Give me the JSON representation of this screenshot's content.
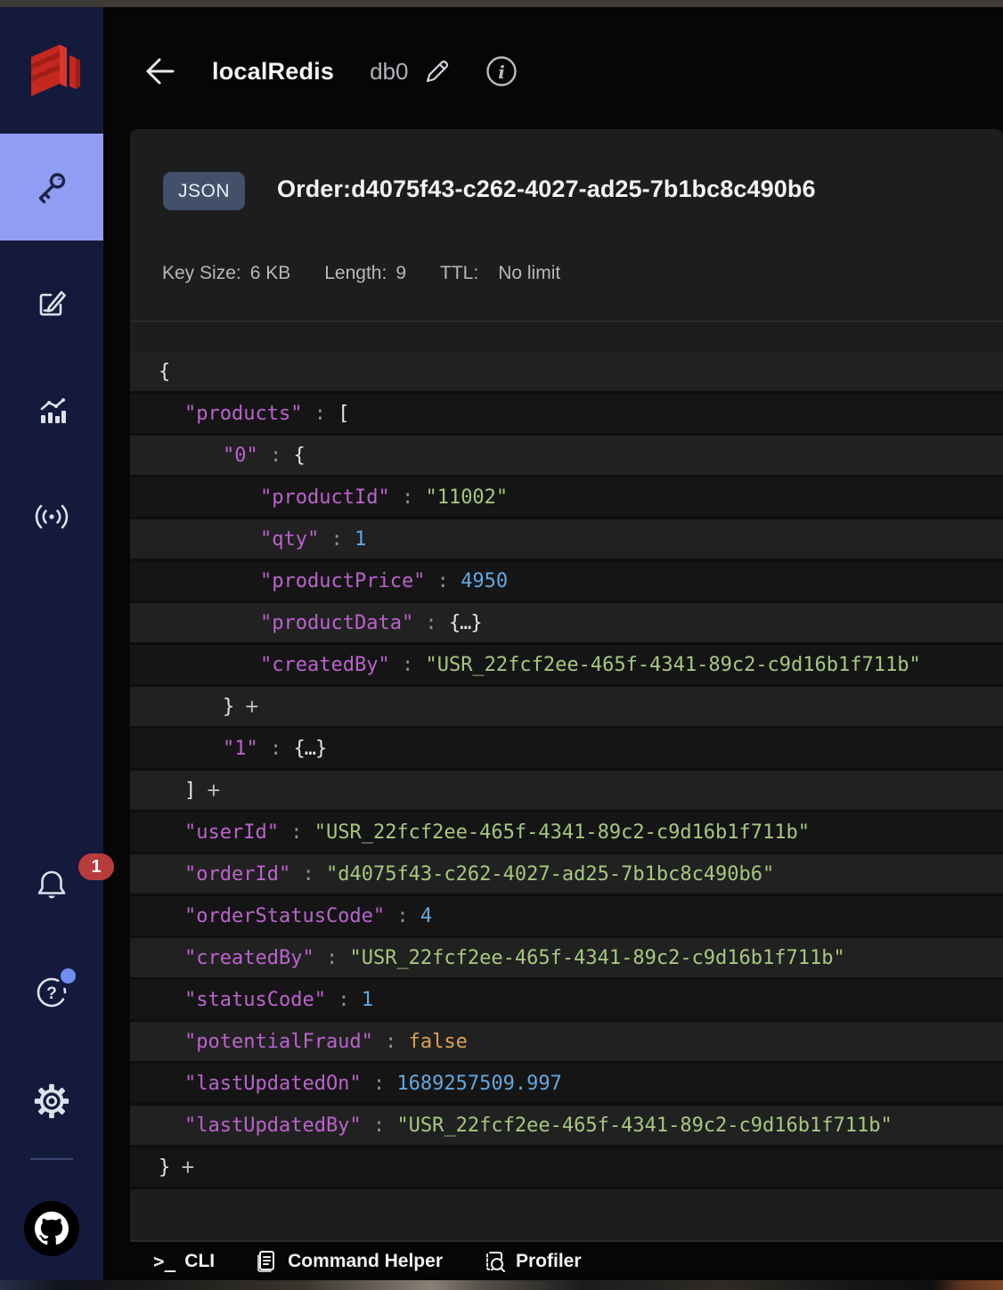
{
  "header": {
    "title": "localRedis",
    "db": "db0"
  },
  "key_panel": {
    "type_badge": "JSON",
    "key_name": "Order:d4075f43-c262-4027-ad25-7b1bc8c490b6",
    "meta": [
      {
        "label": "Key Size:",
        "value": "6 KB"
      },
      {
        "label": "Length:",
        "value": "9"
      },
      {
        "label": "TTL:",
        "value": "No limit"
      }
    ]
  },
  "sidebar": {
    "notification_count": "1",
    "icons": [
      "redis-logo",
      "browser-key-icon",
      "workbench-edit-icon",
      "analytics-icon",
      "pubsub-icon",
      "notifications-bell-icon",
      "help-icon",
      "settings-gear-icon",
      "github-icon"
    ]
  },
  "json_viewer": {
    "rows": [
      {
        "indent": 0,
        "tokens": [
          {
            "t": "{",
            "c": "bracket"
          }
        ]
      },
      {
        "indent": 1,
        "tokens": [
          {
            "t": "\"products\"",
            "c": "key"
          },
          {
            "t": " : ",
            "c": "punct"
          },
          {
            "t": "[",
            "c": "bracket"
          }
        ]
      },
      {
        "indent": 2,
        "tokens": [
          {
            "t": "\"0\"",
            "c": "key"
          },
          {
            "t": " : ",
            "c": "punct"
          },
          {
            "t": "{",
            "c": "bracket"
          }
        ]
      },
      {
        "indent": 3,
        "tokens": [
          {
            "t": "\"productId\"",
            "c": "key"
          },
          {
            "t": " : ",
            "c": "punct"
          },
          {
            "t": "\"11002\"",
            "c": "string"
          }
        ]
      },
      {
        "indent": 3,
        "tokens": [
          {
            "t": "\"qty\"",
            "c": "key"
          },
          {
            "t": " : ",
            "c": "punct"
          },
          {
            "t": "1",
            "c": "number"
          }
        ]
      },
      {
        "indent": 3,
        "tokens": [
          {
            "t": "\"productPrice\"",
            "c": "key"
          },
          {
            "t": " : ",
            "c": "punct"
          },
          {
            "t": "4950",
            "c": "number"
          }
        ]
      },
      {
        "indent": 3,
        "tokens": [
          {
            "t": "\"productData\"",
            "c": "key"
          },
          {
            "t": " : ",
            "c": "punct"
          },
          {
            "t": "{…}",
            "c": "collapsed"
          }
        ]
      },
      {
        "indent": 3,
        "tokens": [
          {
            "t": "\"createdBy\"",
            "c": "key"
          },
          {
            "t": " : ",
            "c": "punct"
          },
          {
            "t": "\"USR_22fcf2ee-465f-4341-89c2-c9d16b1f711b\"",
            "c": "string"
          }
        ]
      },
      {
        "indent": 2,
        "tokens": [
          {
            "t": "}",
            "c": "bracket"
          },
          {
            "t": "+",
            "c": "plus"
          }
        ]
      },
      {
        "indent": 2,
        "tokens": [
          {
            "t": "\"1\"",
            "c": "key"
          },
          {
            "t": " : ",
            "c": "punct"
          },
          {
            "t": "{…}",
            "c": "collapsed"
          }
        ]
      },
      {
        "indent": 1,
        "tokens": [
          {
            "t": "]",
            "c": "bracket"
          },
          {
            "t": "+",
            "c": "plus"
          }
        ]
      },
      {
        "indent": 1,
        "tokens": [
          {
            "t": "\"userId\"",
            "c": "key"
          },
          {
            "t": " : ",
            "c": "punct"
          },
          {
            "t": "\"USR_22fcf2ee-465f-4341-89c2-c9d16b1f711b\"",
            "c": "string"
          }
        ]
      },
      {
        "indent": 1,
        "tokens": [
          {
            "t": "\"orderId\"",
            "c": "key"
          },
          {
            "t": " : ",
            "c": "punct"
          },
          {
            "t": "\"d4075f43-c262-4027-ad25-7b1bc8c490b6\"",
            "c": "string"
          }
        ]
      },
      {
        "indent": 1,
        "tokens": [
          {
            "t": "\"orderStatusCode\"",
            "c": "key"
          },
          {
            "t": " : ",
            "c": "punct"
          },
          {
            "t": "4",
            "c": "number"
          }
        ]
      },
      {
        "indent": 1,
        "tokens": [
          {
            "t": "\"createdBy\"",
            "c": "key"
          },
          {
            "t": " : ",
            "c": "punct"
          },
          {
            "t": "\"USR_22fcf2ee-465f-4341-89c2-c9d16b1f711b\"",
            "c": "string"
          }
        ]
      },
      {
        "indent": 1,
        "tokens": [
          {
            "t": "\"statusCode\"",
            "c": "key"
          },
          {
            "t": " : ",
            "c": "punct"
          },
          {
            "t": "1",
            "c": "number"
          }
        ]
      },
      {
        "indent": 1,
        "tokens": [
          {
            "t": "\"potentialFraud\"",
            "c": "key"
          },
          {
            "t": " : ",
            "c": "punct"
          },
          {
            "t": "false",
            "c": "bool"
          }
        ]
      },
      {
        "indent": 1,
        "tokens": [
          {
            "t": "\"lastUpdatedOn\"",
            "c": "key"
          },
          {
            "t": " : ",
            "c": "punct"
          },
          {
            "t": "1689257509.997",
            "c": "number"
          }
        ]
      },
      {
        "indent": 1,
        "tokens": [
          {
            "t": "\"lastUpdatedBy\"",
            "c": "key"
          },
          {
            "t": " : ",
            "c": "punct"
          },
          {
            "t": "\"USR_22fcf2ee-465f-4341-89c2-c9d16b1f711b\"",
            "c": "string"
          }
        ]
      },
      {
        "indent": 0,
        "tokens": [
          {
            "t": "}",
            "c": "bracket"
          },
          {
            "t": "+",
            "c": "plus"
          }
        ]
      }
    ]
  },
  "bottom_bar": {
    "items": [
      {
        "label": "CLI"
      },
      {
        "label": "Command Helper"
      },
      {
        "label": "Profiler"
      }
    ]
  },
  "colors": {
    "key": "#bb63cc",
    "string": "#a6c87f",
    "number": "#61a8e0",
    "boolean": "#dfa050",
    "punct": "#8a9095",
    "selected_nav": "#8f9ef2",
    "notification_badge": "#b83c3c",
    "type_badge_bg": "#42506a",
    "sidebar_bg": "#141a3c",
    "row_light": "#212121",
    "row_dark": "#151515"
  }
}
